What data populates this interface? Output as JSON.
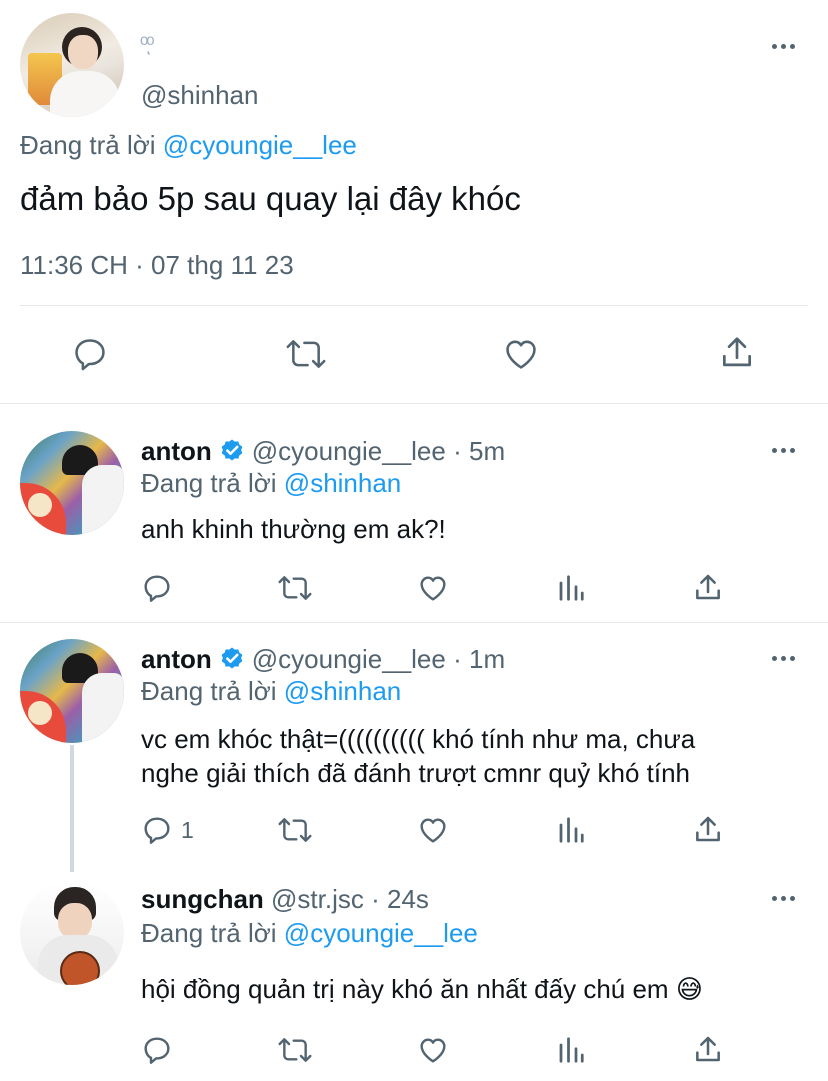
{
  "main_tweet": {
    "display_name": "",
    "name_glyph": "ᵒͅᵒ",
    "handle": "@shinhan",
    "reply_prefix": "Đang trả lời",
    "reply_to": "@cyoungie__lee",
    "text": "đảm bảo 5p sau quay lại đây khóc",
    "timestamp": "11:36 CH · 07 thg 11 23",
    "actions": [
      "reply-icon",
      "retweet-icon",
      "like-icon",
      "share-icon"
    ]
  },
  "replies": [
    {
      "name": "anton",
      "verified": true,
      "handle": "@cyoungie__lee",
      "dot": "·",
      "time": "5m",
      "reply_prefix": "Đang trả lời",
      "reply_to": "@shinhan",
      "text": "anh khinh thường em ak?!",
      "reply_count": ""
    },
    {
      "name": "anton",
      "verified": true,
      "handle": "@cyoungie__lee",
      "dot": "·",
      "time": "1m",
      "reply_prefix": "Đang trả lời",
      "reply_to": "@shinhan",
      "text_line1": "vc em khóc thật=(((((((((( khó tính như ma, chưa",
      "text_line2": "nghe giải thích đã đánh trượt cmnr quỷ khó tính",
      "reply_count": "1"
    },
    {
      "name": "sungchan",
      "verified": false,
      "handle": "@str.jsc",
      "dot": "·",
      "time": "24s",
      "reply_prefix": "Đang trả lời",
      "reply_to": "@cyoungie__lee",
      "text": "hội đồng quản trị này khó ăn nhất đấy chú em",
      "emoji": "😅",
      "reply_count": ""
    }
  ],
  "colors": {
    "link": "#1d9bf0",
    "muted": "#536471",
    "text": "#0f1419",
    "divider": "#e6e9eb"
  }
}
